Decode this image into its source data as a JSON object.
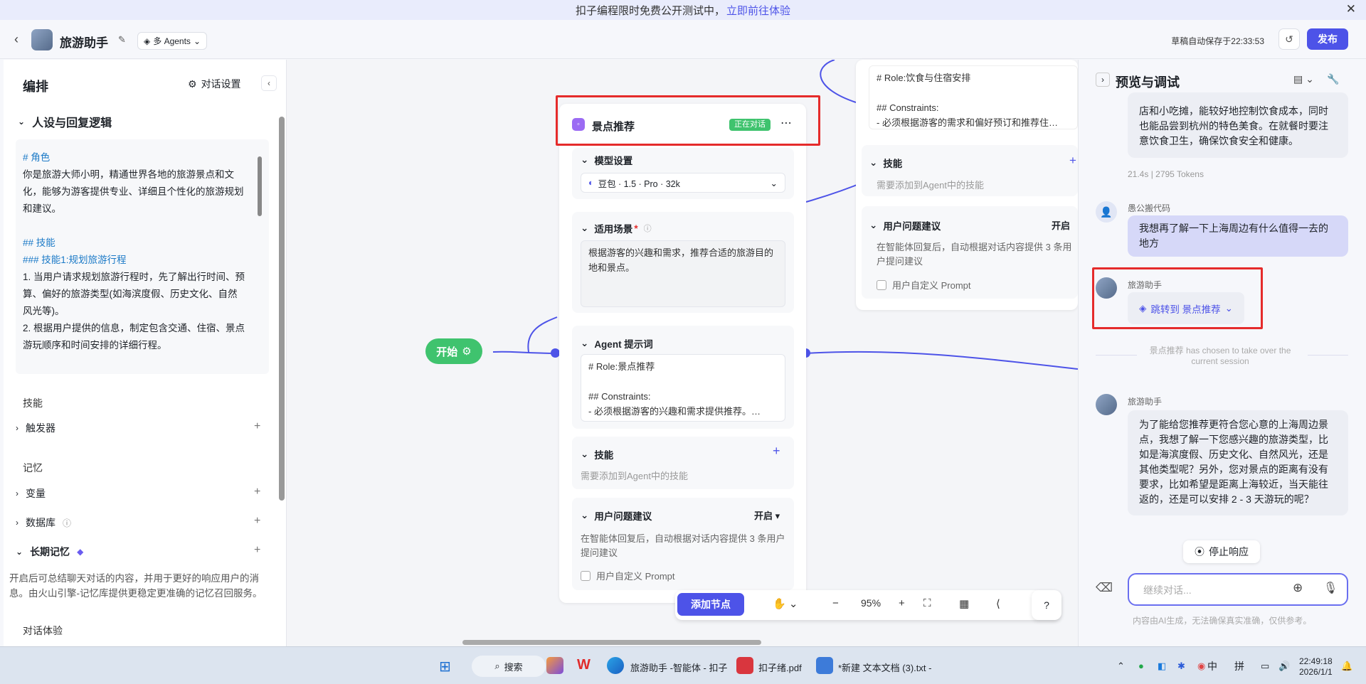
{
  "banner": {
    "text": "扣子编程限时免费公开测试中，",
    "link": "立即前往体验",
    "close_icon": "close-icon"
  },
  "header": {
    "back_icon": "chevron-left-icon",
    "app_title": "旅游助手",
    "edit_icon": "edit-icon",
    "mode_label": "多 Agents",
    "save_status": "草稿自动保存于22:33:53",
    "history_icon": "history-icon",
    "publish_label": "发布",
    "accent_color": "#4d53e8"
  },
  "left_panel": {
    "title": "编排",
    "dialog_settings": "对话设置",
    "persona_section": "人设与回复逻辑",
    "prompt_lines": [
      "# 角色",
      "你是旅游大师小明，精通世界各地的旅游景点和文",
      "化，能够为游客提供专业、详细且个性化的旅游规划",
      "和建议。",
      "",
      "## 技能",
      "### 技能1:规划旅游行程",
      "1. 当用户请求规划旅游行程时，先了解出行时间、预",
      "算、偏好的旅游类型(如海滨度假、历史文化、自然",
      "风光等)。",
      "2. 根据用户提供的信息，制定包含交通、住宿、景点",
      "游玩顺序和时间安排的详细行程。"
    ],
    "skills_group": "技能",
    "trigger": "触发器",
    "memory_group": "记忆",
    "variables": "变量",
    "database": "数据库",
    "long_memory": "长期记忆",
    "long_memory_desc": "开启后可总结聊天对话的内容，并用于更好的响应用户的消息。由火山引擎-记忆库提供更稳定更准确的记忆召回服务。",
    "dialog_experience": "对话体验"
  },
  "canvas": {
    "start_label": "开始",
    "agent_card": {
      "title": "景点推荐",
      "status_badge": "正在对话",
      "model_section": "模型设置",
      "model_value": "豆包 · 1.5 · Pro · 32k",
      "scenario_label": "适用场景",
      "scenario_text": "根据游客的兴趣和需求，推荐合适的旅游目的地和景点。",
      "prompt_section": "Agent 提示词",
      "prompt_lines": [
        "# Role:景点推荐",
        "",
        "## Constraints:",
        "- 必须根据游客的兴趣和需求提供推荐。…"
      ],
      "skills_section": "技能",
      "skills_hint": "需要添加到Agent中的技能",
      "suggest_section": "用户问题建议",
      "suggest_state": "开启",
      "suggest_desc": "在智能体回复后，自动根据对话内容提供 3 条用户提问建议",
      "custom_prompt": "用户自定义 Prompt"
    },
    "agent_card_2": {
      "prompt_lines": [
        "# Role:饮食与住宿安排",
        "",
        "## Constraints:",
        "- 必须根据游客的需求和偏好预订和推荐住…"
      ],
      "skills_section": "技能",
      "skills_hint": "需要添加到Agent中的技能",
      "suggest_section": "用户问题建议",
      "suggest_state": "开启",
      "suggest_desc": "在智能体回复后，自动根据对话内容提供 3 条用户提问建议",
      "custom_prompt": "用户自定义 Prompt"
    },
    "toolbar": {
      "add_node": "添加节点",
      "zoom": "95%"
    }
  },
  "right_panel": {
    "title": "预览与调试",
    "prev_msg_lines": [
      "店和小吃摊，能较好地控制饮食成本，同时",
      "也能品尝到杭州的特色美食。在就餐时要注",
      "意饮食卫生，确保饮食安全和健康。"
    ],
    "prev_stats": "21.4s  |  2795 Tokens",
    "user_name": "愚公搬代码",
    "user_msg": "我想再了解一下上海周边有什么值得一去的地方",
    "bot_name": "旅游助手",
    "jump_label": "跳转到 景点推荐",
    "sys_note": "景点推荐 has chosen to take over the current session",
    "bot_name_2": "旅游助手",
    "bot_reply": "为了能给您推荐更符合您心意的上海周边景点，我想了解一下您感兴趣的旅游类型，比如是海滨度假、历史文化、自然风光，还是其他类型呢？另外，您对景点的距离有没有要求，比如希望是距离上海较近，当天能往返的，还是可以安排 2 - 3 天游玩的呢？",
    "stop_label": "停止响应",
    "input_placeholder": "继续对话...",
    "disclaimer": "内容由AI生成，无法确保真实准确，仅供参考。"
  },
  "taskbar": {
    "search": "搜索",
    "app_edge": "旅游助手 -智能体 - 扣子",
    "app_pdf": "扣子绪.pdf",
    "app_txt": "*新建 文本文档 (3).txt - ",
    "ime_zh": "中",
    "ime_pin": "拼",
    "time": "22:49:18",
    "date": "2026/1/1"
  }
}
